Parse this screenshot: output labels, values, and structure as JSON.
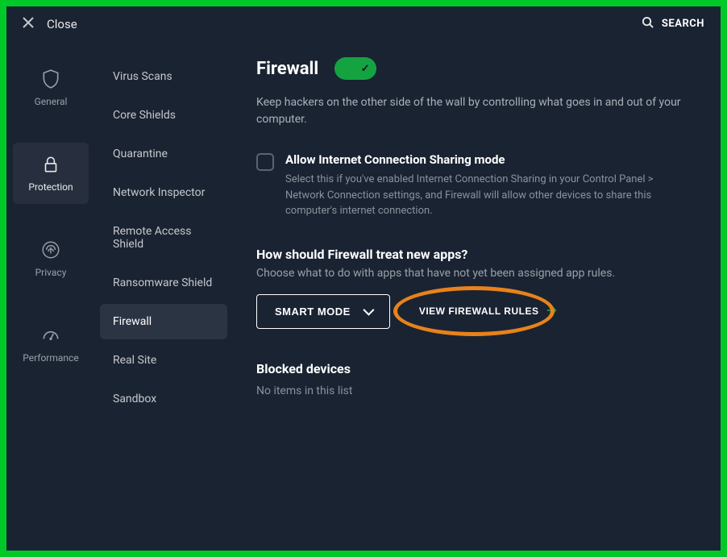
{
  "header": {
    "close_label": "Close",
    "search_label": "SEARCH"
  },
  "sidebar": {
    "categories": [
      {
        "label": "General"
      },
      {
        "label": "Protection"
      },
      {
        "label": "Privacy"
      },
      {
        "label": "Performance"
      }
    ],
    "sub_items": [
      {
        "label": "Virus Scans"
      },
      {
        "label": "Core Shields"
      },
      {
        "label": "Quarantine"
      },
      {
        "label": "Network Inspector"
      },
      {
        "label": "Remote Access Shield"
      },
      {
        "label": "Ransomware Shield"
      },
      {
        "label": "Firewall"
      },
      {
        "label": "Real Site"
      },
      {
        "label": "Sandbox"
      }
    ]
  },
  "main": {
    "title": "Firewall",
    "toggle_on": true,
    "description": "Keep hackers on the other side of the wall by controlling what goes in and out of your computer.",
    "option_ics": {
      "label": "Allow Internet Connection Sharing mode",
      "description": "Select this if you've enabled Internet Connection Sharing in your Control Panel > Network Connection settings, and Firewall will allow other devices to share this computer's internet connection."
    },
    "new_apps": {
      "title": "How should Firewall treat new apps?",
      "description": "Choose what to do with apps that have not yet been assigned app rules.",
      "mode_button": "SMART MODE",
      "rules_link": "VIEW FIREWALL RULES"
    },
    "blocked": {
      "title": "Blocked devices",
      "empty": "No items in this list"
    }
  },
  "colors": {
    "accent_green": "#15a342",
    "highlight_orange": "#e8821a"
  }
}
